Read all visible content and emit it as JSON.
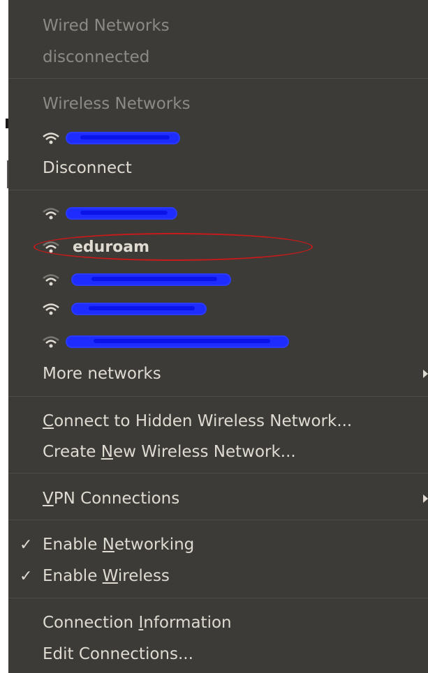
{
  "wired": {
    "header": "Wired Networks",
    "status": "disconnected"
  },
  "wireless": {
    "header": "Wireless Networks",
    "disconnect_label": "Disconnect",
    "highlighted_network": "eduroam",
    "more_networks": "More networks"
  },
  "actions": {
    "connect_hidden": {
      "before": "",
      "mnemonic": "C",
      "after": "onnect to Hidden Wireless Network..."
    },
    "create_new": {
      "before": "Create ",
      "mnemonic": "N",
      "after": "ew Wireless Network..."
    },
    "vpn": {
      "before": "",
      "mnemonic": "V",
      "after": "PN Connections"
    }
  },
  "toggles": {
    "check_glyph": "✓",
    "enable_networking": {
      "before": "Enable ",
      "mnemonic": "N",
      "after": "etworking"
    },
    "enable_wireless": {
      "before": "Enable ",
      "mnemonic": "W",
      "after": "ireless"
    }
  },
  "info": {
    "connection_information": {
      "before": "Connection ",
      "mnemonic": "I",
      "after": "nformation"
    },
    "edit_connections": "Edit Connections..."
  },
  "colors": {
    "menu_bg": "#3c3b37",
    "text": "#dfdbd2",
    "disabled_text": "#8c8a85",
    "redaction": "#1f2cff",
    "highlight_ring": "#c81a1a"
  }
}
